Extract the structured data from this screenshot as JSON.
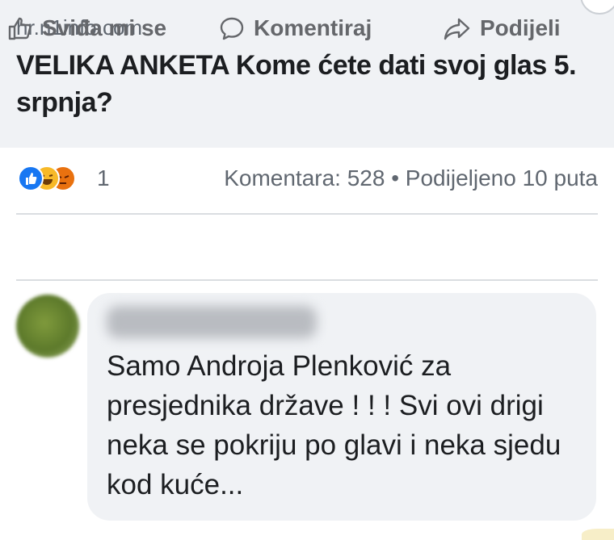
{
  "link_preview": {
    "domain": "hr.n1info.com",
    "headline": "VELIKA ANKETA Kome ćete dati svoj glas 5. srpnja?"
  },
  "stats": {
    "reactions": [
      "like-icon",
      "haha-icon",
      "angry-icon"
    ],
    "reaction_count": "1",
    "comments_shares": "Komentara: 528 • Podijeljeno 10 puta"
  },
  "actions": {
    "like_label": "Sviđa mi se",
    "comment_label": "Komentiraj",
    "share_label": "Podijeli"
  },
  "comment": {
    "text": "Samo Androja Plenković za presjednika države ! ! ! Svi ovi drigi neka se pokriju po glavi i neka sjedu kod kuće..."
  },
  "colors": {
    "like": "#1877f2",
    "haha": "#f7b928",
    "angry": "#e9710f",
    "card_background": "#f0f2f5"
  }
}
